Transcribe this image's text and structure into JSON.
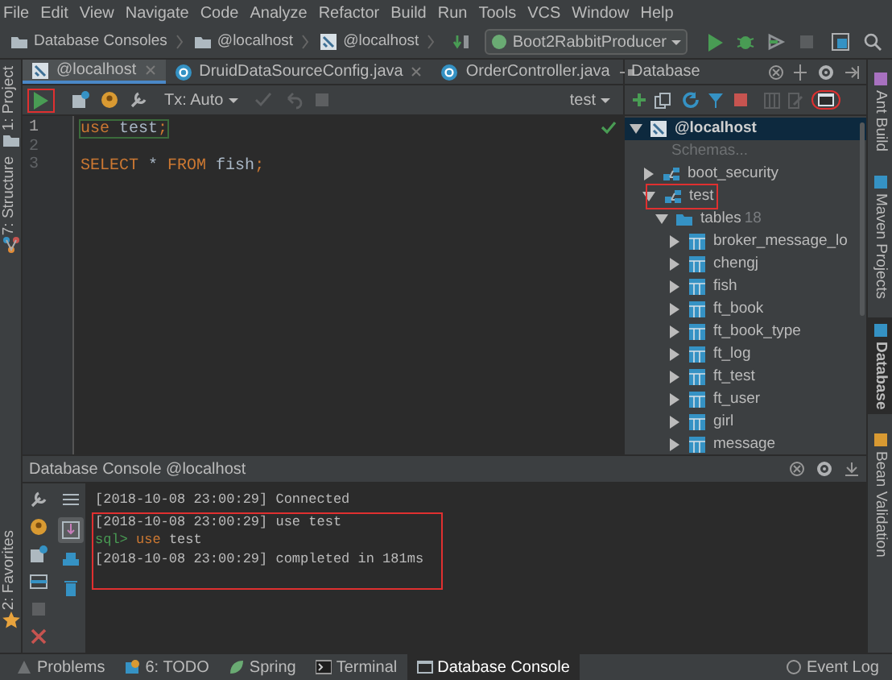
{
  "menu": [
    "File",
    "Edit",
    "View",
    "Navigate",
    "Code",
    "Analyze",
    "Refactor",
    "Build",
    "Run",
    "Tools",
    "VCS",
    "Window",
    "Help"
  ],
  "breadcrumbs": [
    {
      "label": "Database Consoles",
      "kind": "folder"
    },
    {
      "label": "@localhost",
      "kind": "folder"
    },
    {
      "label": "@localhost",
      "kind": "datasource"
    }
  ],
  "run_configuration": "Boot2RabbitProducer",
  "left_tool_windows": [
    {
      "label": "1: Project",
      "kind": "project"
    },
    {
      "label": "7: Structure",
      "kind": "structure"
    },
    {
      "label": "2: Favorites",
      "kind": "favorites"
    }
  ],
  "right_tool_windows": [
    {
      "label": "Ant Build",
      "selected": false
    },
    {
      "label": "Maven Projects",
      "selected": false
    },
    {
      "label": "Database",
      "selected": true
    },
    {
      "label": "Bean Validation",
      "selected": false
    }
  ],
  "editor": {
    "tabs": [
      {
        "label": "@localhost",
        "kind": "console",
        "selected": true,
        "closable": true
      },
      {
        "label": "DruidDataSourceConfig.java",
        "kind": "class",
        "selected": false,
        "closable": true
      },
      {
        "label": "OrderController.java",
        "kind": "class",
        "selected": false,
        "closable": false
      }
    ],
    "run_highlighted": true,
    "transaction_mode": "Tx: Auto",
    "schema": "test",
    "lines": [
      {
        "number": "1",
        "current": true,
        "tokens": [
          {
            "text": "use",
            "kind": "keyword"
          },
          {
            "text": " test",
            "kind": "plain"
          },
          {
            "text": ";",
            "kind": "keyword"
          }
        ]
      },
      {
        "number": "2",
        "current": false
      },
      {
        "number": "3",
        "current": false,
        "tokens": [
          {
            "text": "SELECT",
            "kind": "keyword"
          },
          {
            "text": " * ",
            "kind": "plain"
          },
          {
            "text": "FROM",
            "kind": "keyword"
          },
          {
            "text": " fish",
            "kind": "plain"
          },
          {
            "text": ";",
            "kind": "keyword"
          }
        ]
      }
    ]
  },
  "database": {
    "title": "Database",
    "console_highlighted": true,
    "tree": [
      {
        "label": "@localhost",
        "kind": "datasource",
        "expanded": true,
        "selected": true,
        "children": [
          {
            "label": "Schemas...",
            "kind": "hint"
          },
          {
            "label": "boot_security",
            "kind": "schema",
            "expanded": false,
            "selected": false,
            "highlighted": false
          },
          {
            "label": "test",
            "kind": "schema",
            "expanded": true,
            "selected": false,
            "highlighted": true,
            "children": [
              {
                "label": "tables",
                "count": "18",
                "kind": "folder",
                "expanded": true,
                "selected": false,
                "children": [
                  {
                    "label": "broker_message_lo",
                    "kind": "table",
                    "expanded": false,
                    "selected": false
                  },
                  {
                    "label": "chengj",
                    "kind": "table",
                    "expanded": false,
                    "selected": false
                  },
                  {
                    "label": "fish",
                    "kind": "table",
                    "expanded": false,
                    "selected": false
                  },
                  {
                    "label": "ft_book",
                    "kind": "table",
                    "expanded": false,
                    "selected": false
                  },
                  {
                    "label": "ft_book_type",
                    "kind": "table",
                    "expanded": false,
                    "selected": false
                  },
                  {
                    "label": "ft_log",
                    "kind": "table",
                    "expanded": false,
                    "selected": false
                  },
                  {
                    "label": "ft_test",
                    "kind": "table",
                    "expanded": false,
                    "selected": false
                  },
                  {
                    "label": "ft_user",
                    "kind": "table",
                    "expanded": false,
                    "selected": false
                  },
                  {
                    "label": "girl",
                    "kind": "table",
                    "expanded": false,
                    "selected": false
                  },
                  {
                    "label": "message",
                    "kind": "table",
                    "expanded": false,
                    "selected": false
                  }
                ]
              }
            ]
          }
        ]
      }
    ]
  },
  "console": {
    "title": "Database Console @localhost",
    "blocks": [
      {
        "highlighted": false,
        "lines": [
          {
            "kind": "log",
            "time": "[2018-10-08 23:00:29]",
            "text": "Connected"
          }
        ]
      },
      {
        "highlighted": true,
        "lines": [
          {
            "kind": "log",
            "time": "[2018-10-08 23:00:29]",
            "text": "use test"
          },
          {
            "kind": "prompt",
            "prompt": "sql>",
            "keyword": "use",
            "text": "test"
          },
          {
            "kind": "log",
            "time": "[2018-10-08 23:00:29]",
            "text": "completed in 181ms"
          }
        ]
      }
    ]
  },
  "status_bar": {
    "tabs": [
      {
        "label": "Problems",
        "kind": "problems",
        "selected": false
      },
      {
        "label": "6: TODO",
        "kind": "todo",
        "selected": false
      },
      {
        "label": "Spring",
        "kind": "spring",
        "selected": false
      },
      {
        "label": "Terminal",
        "kind": "terminal",
        "selected": false
      },
      {
        "label": "Database Console",
        "kind": "console",
        "selected": true
      }
    ],
    "event_log": "Event Log"
  }
}
